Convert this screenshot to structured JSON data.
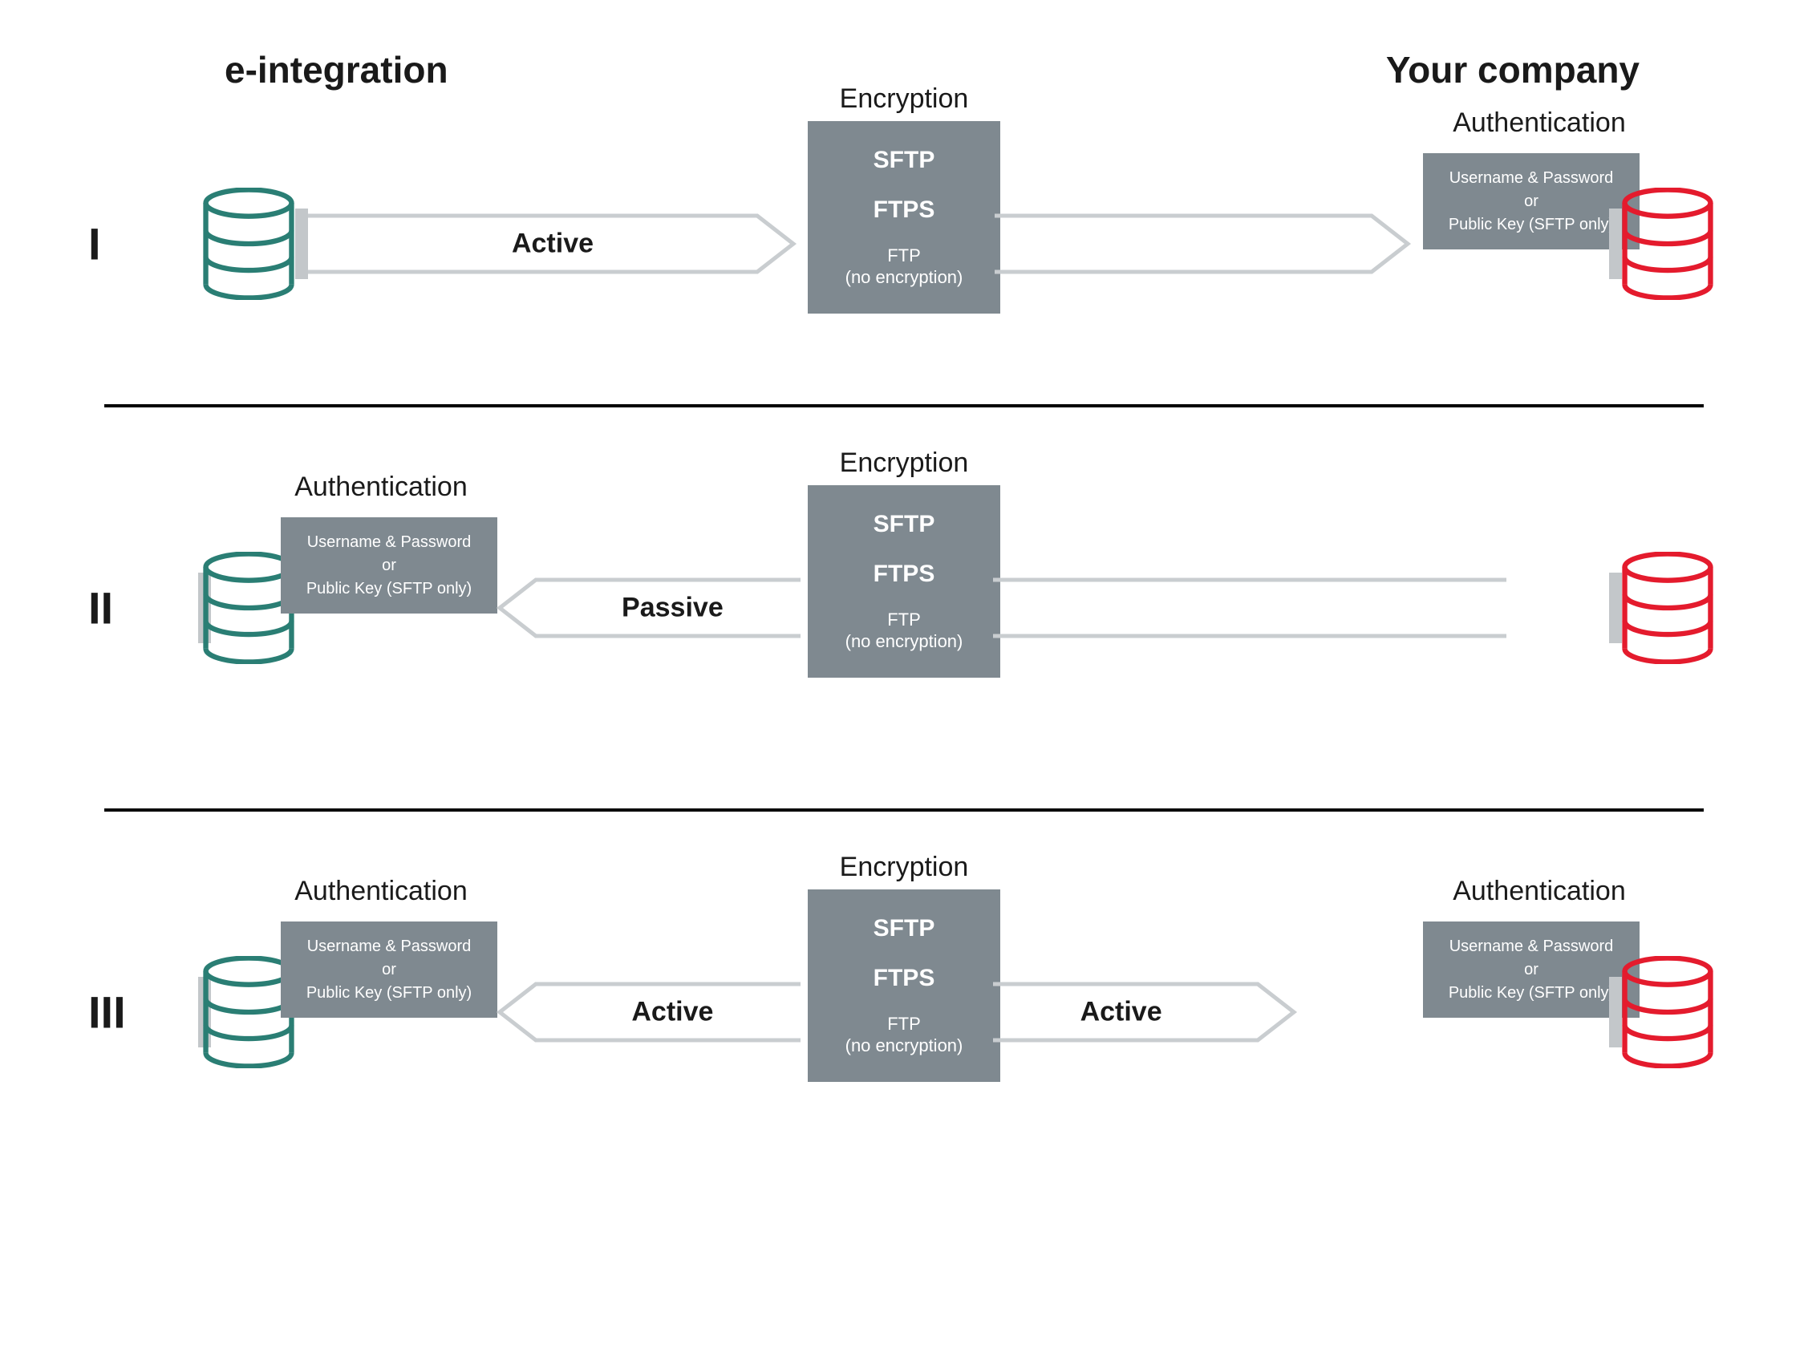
{
  "headers": {
    "left": "e-integration",
    "right": "Your company"
  },
  "labels": {
    "encryption_title": "Encryption",
    "authentication_title": "Authentication",
    "sftp": "SFTP",
    "ftps": "FTPS",
    "ftp": "FTP",
    "no_enc": "(no encryption)",
    "auth_l1": "Username & Password",
    "auth_l2": "or",
    "auth_l3": "Public Key (SFTP only)",
    "active": "Active",
    "passive": "Passive"
  },
  "rows": {
    "r1": {
      "roman": "I",
      "left_label": "Active",
      "right_label": "",
      "auth_left": false,
      "auth_right": true,
      "pipe_dir": "right"
    },
    "r2": {
      "roman": "II",
      "left_label": "Passive",
      "right_label": "",
      "auth_left": true,
      "auth_right": false,
      "pipe_dir": "left"
    },
    "r3": {
      "roman": "III",
      "left_label": "Active",
      "right_label": "Active",
      "auth_left": true,
      "auth_right": true,
      "pipe_dir": "both"
    }
  },
  "colors": {
    "teal": "#2a7e74",
    "red": "#e41b2d",
    "grey": "#7f8990",
    "line": "#c9cdd0"
  }
}
